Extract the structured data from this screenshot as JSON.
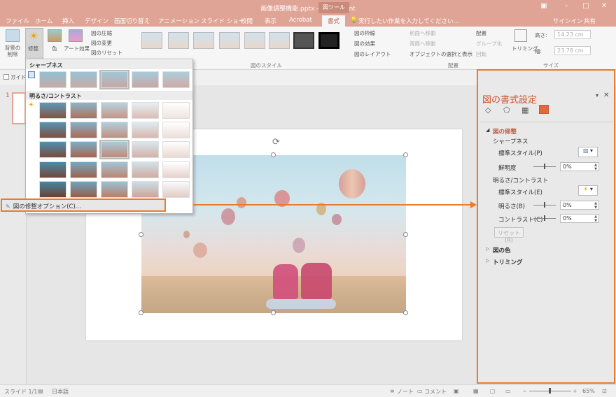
{
  "window": {
    "title": "画像調整機能.pptx - PowerPoint",
    "context_tool": "図ツール",
    "controls": [
      "?",
      "–",
      "□",
      "✕"
    ]
  },
  "tabs": [
    "ファイル",
    "ホーム",
    "挿入",
    "デザイン",
    "画面切り替え",
    "アニメーション",
    "スライド ショー",
    "校閲",
    "表示",
    "Acrobat",
    "書式"
  ],
  "tell_me": "実行したい作業を入力してください...",
  "signin": "サインイン",
  "share": "共有",
  "ribbon": {
    "remove_bg": "背景の削除",
    "corrections": "修整",
    "color": "色",
    "artistic": "アート効果",
    "compress": "図の圧縮",
    "change": "図の変更",
    "reset": "図のリセット",
    "styles_group": "図のスタイル",
    "border": "図の枠線",
    "effects": "図の効果",
    "layout": "図のレイアウト",
    "bring_forward": "前面へ移動",
    "send_backward": "背面へ移動",
    "selection_pane": "オブジェクトの選択と表示",
    "align": "配置",
    "group": "グループ化",
    "rotate": "回転",
    "arrange_group": "配置",
    "crop": "トリミング",
    "height_label": "高さ:",
    "height_value": "14.23 cm",
    "width_label": "幅:",
    "width_value": "23.78 cm",
    "size_group": "サイズ"
  },
  "guide_label": "ガイド",
  "slide_number": "1",
  "dropdown": {
    "sharpness_header": "シャープネス",
    "brightness_header": "明るさ/コントラスト",
    "option_label": "図の修整オプション(C)..."
  },
  "pane": {
    "title": "図の書式設定",
    "section": "図の修整",
    "sharpness": "シャープネス",
    "preset1": "標準スタイル(P)",
    "sharpness_label": "鮮明度",
    "sharpness_value": "0%",
    "bc": "明るさ/コントラスト",
    "preset2": "標準スタイル(E)",
    "brightness_label": "明るさ(B)",
    "brightness_value": "0%",
    "contrast_label": "コントラスト(C)",
    "contrast_value": "0%",
    "reset": "リセット(R)",
    "color_section": "図の色",
    "crop_section": "トリミング"
  },
  "status": {
    "slide": "スライド 1/1",
    "lang": "日本語",
    "notes": "ノート",
    "comments": "コメント",
    "zoom": "65%"
  },
  "colors": {
    "accent": "#e97b2d",
    "titlebar": "#dfa495",
    "pane_title": "#d0522b"
  }
}
